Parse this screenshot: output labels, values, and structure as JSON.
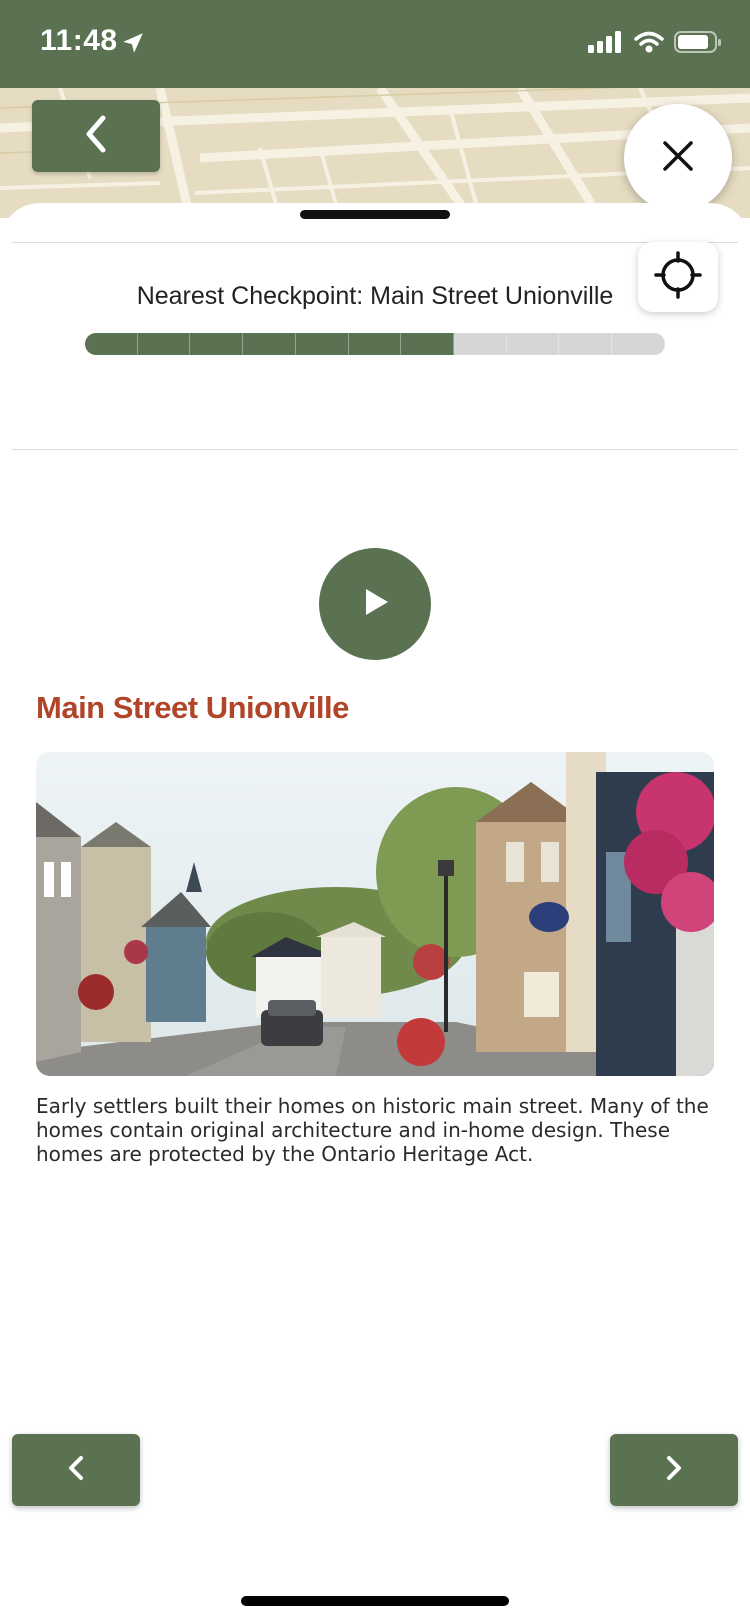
{
  "status_bar": {
    "time": "11:48",
    "icons": [
      "location-arrow-icon",
      "cellular-signal-icon",
      "wifi-icon",
      "battery-icon"
    ]
  },
  "header": {
    "back_icon": "chevron-left-icon",
    "close_icon": "close-icon",
    "locate_icon": "crosshair-icon"
  },
  "checkpoint": {
    "nearest_label": "Nearest Checkpoint: Main Street Unionville",
    "progress_total": 11,
    "progress_completed": 7
  },
  "content": {
    "play_icon": "play-icon",
    "title": "Main Street Unionville",
    "description": "Early settlers built their homes on historic main street. Many of the homes contain original architecture and in-home design. These homes are protected by the Ontario Heritage Act."
  },
  "footer": {
    "prev_icon": "chevron-left-icon",
    "next_icon": "chevron-right-icon"
  },
  "colors": {
    "primary": "#5a7152",
    "title": "#b0452a",
    "progress_track": "#d6d6d6"
  }
}
